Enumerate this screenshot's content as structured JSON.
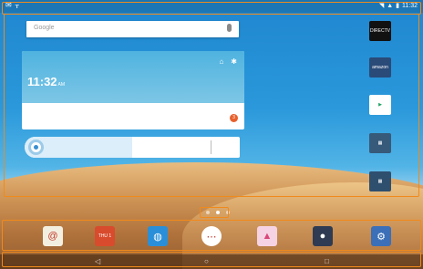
{
  "status_bar": {
    "left_icons": [
      "notification-icon",
      "usb-icon"
    ],
    "right_icons": [
      "wifi-icon",
      "signal-icon",
      "battery-icon"
    ],
    "time": "11:32"
  },
  "search_widget": {
    "placeholder": "Google",
    "icon": "mic-icon"
  },
  "clock_widget": {
    "time": "11:32",
    "ampm": "AM",
    "badge": "3"
  },
  "music_widget": {
    "progress": 0.5
  },
  "right_apps": [
    {
      "name": "DIRECTV",
      "label": "DIRECTV",
      "color": "#111111"
    },
    {
      "name": "Amazon",
      "label": "amazon",
      "color": "#2a4a78"
    },
    {
      "name": "Play Store",
      "label": "▶",
      "color": "#ffffff"
    },
    {
      "name": "Folder 1",
      "label": "▦",
      "color": "#375a7a"
    },
    {
      "name": "Folder 2",
      "label": "▦",
      "color": "#2f4f6e"
    }
  ],
  "page_indicator": {
    "count": 3,
    "active": 1
  },
  "dock_apps": [
    {
      "name": "Email",
      "icon": "email-icon",
      "glyph": "@",
      "color": "#f3efe0"
    },
    {
      "name": "Calendar",
      "icon": "calendar-icon",
      "glyph": "THU 1",
      "color": "#d84b2c"
    },
    {
      "name": "Browser",
      "icon": "globe-icon",
      "glyph": "◍",
      "color": "#2a8fd8"
    },
    {
      "name": "Apps",
      "icon": "apps-grid-icon",
      "glyph": "⋯",
      "color": "#ffffff"
    },
    {
      "name": "Gallery",
      "icon": "gallery-icon",
      "glyph": "▲",
      "color": "#f6d3e4"
    },
    {
      "name": "Camera",
      "icon": "camera-icon",
      "glyph": "●",
      "color": "#2e3b52"
    },
    {
      "name": "Settings",
      "icon": "settings-icon",
      "glyph": "⚙",
      "color": "#3b6fb8"
    }
  ],
  "nav_bar": {
    "back": "◁",
    "home": "○",
    "recents": "□"
  }
}
